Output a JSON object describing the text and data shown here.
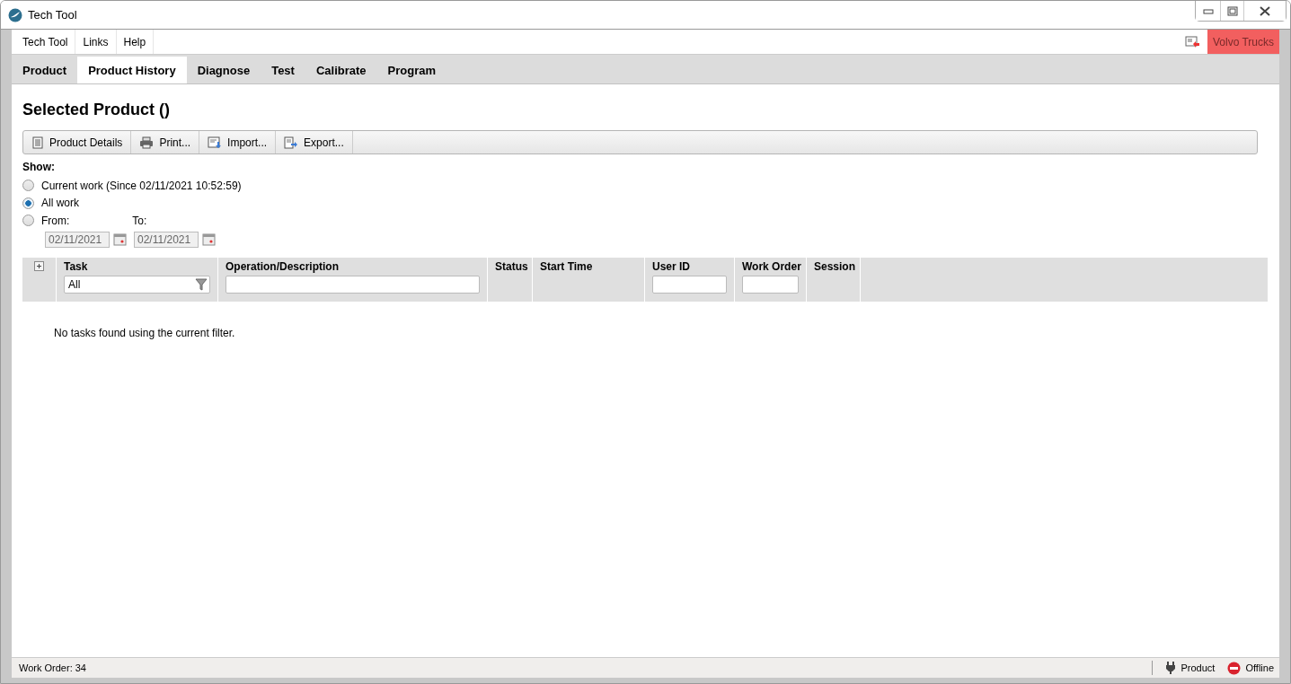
{
  "window": {
    "title": "Tech Tool"
  },
  "menu": [
    "Tech Tool",
    "Links",
    "Help"
  ],
  "brand": "Volvo Trucks",
  "tabs": [
    {
      "label": "Product",
      "selected": false
    },
    {
      "label": "Product History",
      "selected": true
    },
    {
      "label": "Diagnose",
      "selected": false
    },
    {
      "label": "Test",
      "selected": false
    },
    {
      "label": "Calibrate",
      "selected": false
    },
    {
      "label": "Program",
      "selected": false
    }
  ],
  "heading": "Selected Product ()",
  "toolbar": [
    {
      "kind": "details",
      "label": "Product Details"
    },
    {
      "kind": "print",
      "label": "Print..."
    },
    {
      "kind": "import",
      "label": "Import..."
    },
    {
      "kind": "export",
      "label": "Export..."
    }
  ],
  "show": {
    "label": "Show:",
    "options": [
      {
        "label": "Current work (Since 02/11/2021 10:52:59)",
        "selected": false
      },
      {
        "label": "All work",
        "selected": true
      },
      {
        "label": "From:",
        "to_label": "To:",
        "selected": false
      }
    ],
    "from_date": "02/11/2021",
    "to_date": "02/11/2021"
  },
  "table": {
    "columns": [
      {
        "label": "Task",
        "kind": "select",
        "value": "All"
      },
      {
        "label": "Operation/Description",
        "kind": "text"
      },
      {
        "label": "Status",
        "kind": "plain"
      },
      {
        "label": "Start Time",
        "kind": "plain"
      },
      {
        "label": "User ID",
        "kind": "text"
      },
      {
        "label": "Work Order",
        "kind": "text"
      },
      {
        "label": "Session",
        "kind": "plain"
      }
    ],
    "empty_message": "No tasks found using the current filter."
  },
  "status_bar": {
    "work_order": "Work Order: 34",
    "product": "Product",
    "connection": "Offline"
  }
}
